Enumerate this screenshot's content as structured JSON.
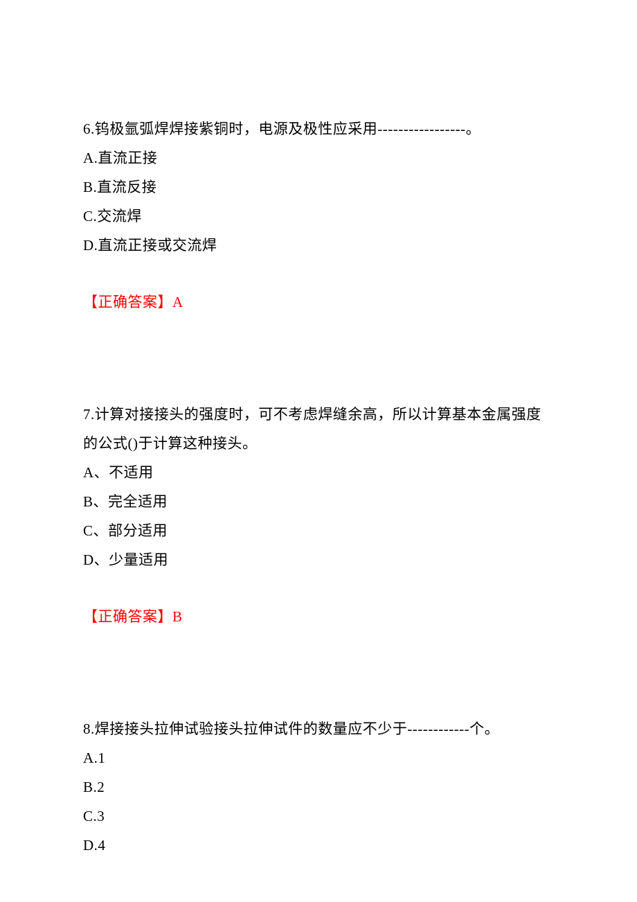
{
  "questions": [
    {
      "stem": "6.钨极氩弧焊焊接紫铜时，电源及极性应采用-----------------。",
      "options": [
        "A.直流正接",
        "B.直流反接",
        "C.交流焊",
        "D.直流正接或交流焊"
      ],
      "answer_label": "【正确答案】",
      "answer_value": "A"
    },
    {
      "stem": "7.计算对接接头的强度时，可不考虑焊缝余高，所以计算基本金属强度的公式()于计算这种接头。",
      "options": [
        "A、不适用",
        "B、完全适用",
        "C、部分适用",
        "D、少量适用"
      ],
      "answer_label": "【正确答案】",
      "answer_value": "B"
    },
    {
      "stem": "8.焊接接头拉伸试验接头拉伸试件的数量应不少于------------个。",
      "options": [
        "A.1",
        "B.2",
        "C.3",
        "D.4"
      ],
      "answer_label": "",
      "answer_value": ""
    }
  ]
}
